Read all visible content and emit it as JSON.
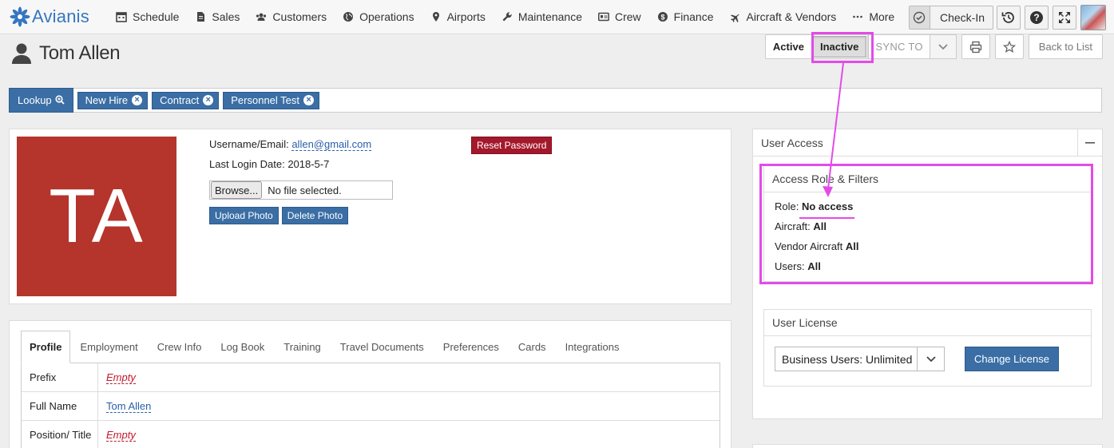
{
  "brand": {
    "name": "Avianis"
  },
  "nav": {
    "items": [
      {
        "label": "Schedule",
        "icon": "calendar-icon"
      },
      {
        "label": "Sales",
        "icon": "document-icon"
      },
      {
        "label": "Customers",
        "icon": "users-icon"
      },
      {
        "label": "Operations",
        "icon": "globe-icon"
      },
      {
        "label": "Airports",
        "icon": "map-pin-icon"
      },
      {
        "label": "Maintenance",
        "icon": "wrench-icon"
      },
      {
        "label": "Crew",
        "icon": "id-card-icon"
      },
      {
        "label": "Finance",
        "icon": "dollar-icon"
      },
      {
        "label": "Aircraft & Vendors",
        "icon": "plane-icon"
      },
      {
        "label": "More",
        "icon": "ellipsis-icon"
      }
    ],
    "checkin_label": "Check-In"
  },
  "person": {
    "name": "Tom Allen",
    "initials": "TA"
  },
  "header_actions": {
    "active_label": "Active",
    "inactive_label": "Inactive",
    "sync_label": "SYNC TO",
    "back_label": "Back to List"
  },
  "tags": {
    "lookup_label": "Lookup",
    "items": [
      "New Hire",
      "Contract",
      "Personnel Test"
    ]
  },
  "account": {
    "username_label": "Username/Email:",
    "username_value": "allen@gmail.com",
    "last_login_label": "Last Login Date:",
    "last_login_value": "2018-5-7",
    "browse_label": "Browse...",
    "file_status": "No file selected.",
    "upload_label": "Upload Photo",
    "delete_label": "Delete Photo",
    "reset_label": "Reset Password"
  },
  "profile_tabs": [
    "Profile",
    "Employment",
    "Crew Info",
    "Log Book",
    "Training",
    "Travel Documents",
    "Preferences",
    "Cards",
    "Integrations"
  ],
  "profile_fields": [
    {
      "label": "Prefix",
      "value": "Empty",
      "empty": true
    },
    {
      "label": "Full Name",
      "value": "Tom Allen",
      "empty": false
    },
    {
      "label": "Position/ Title",
      "value": "Empty",
      "empty": true
    }
  ],
  "user_access": {
    "title": "User Access",
    "role_panel_title": "Access Role & Filters",
    "role_label": "Role:",
    "role_value": "No access",
    "aircraft_label": "Aircraft:",
    "aircraft_value": "All",
    "vendor_aircraft_label": "Vendor Aircraft",
    "vendor_aircraft_value": "All",
    "users_label": "Users:",
    "users_value": "All",
    "license_title": "User License",
    "license_value": "Business Users: Unlimited",
    "change_license_label": "Change License"
  },
  "colors": {
    "brand_blue": "#3576c0",
    "button_blue": "#3a6ea5",
    "danger_red": "#a4182c",
    "avatar_red": "#b5342b",
    "highlight_magenta": "#e34be8"
  }
}
